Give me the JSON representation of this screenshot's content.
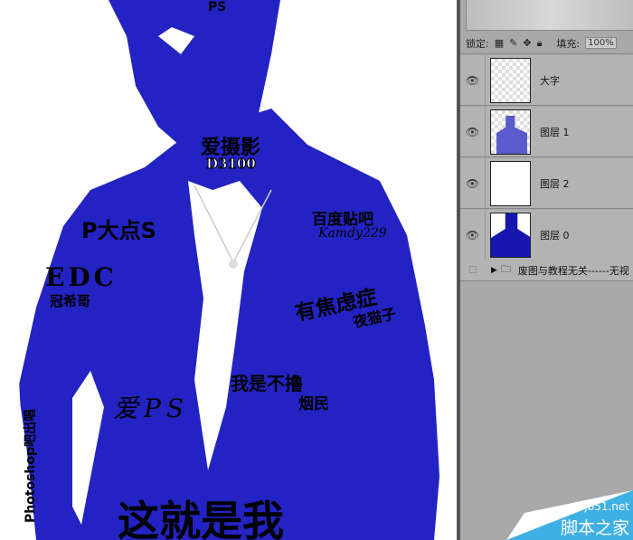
{
  "canvas": {
    "texts": {
      "ps": "PS",
      "love_photo": "爱摄影",
      "camera": "D3100",
      "p_big": "P大点S",
      "baidu": "百度贴吧",
      "kamdy": "Kamdy229",
      "edc": "EDC",
      "guanxi": "冠希哥",
      "anxiety": "有焦虑症",
      "nightowl": "夜猫子",
      "no_smoke": "我是不撸",
      "smoker": "烟民",
      "love_ps": "爱PS",
      "vertical": "Photoshop吧出唱",
      "this_is_me": "这就是我"
    },
    "fill_color": "#2323c4"
  },
  "panel": {
    "lock_label": "锁定:",
    "fill_label": "填充:",
    "fill_value": "100%",
    "layers": [
      {
        "name": "大字",
        "visible": true
      },
      {
        "name": "图层 1",
        "visible": true
      },
      {
        "name": "图层 2",
        "visible": true
      },
      {
        "name": "图层 0",
        "visible": true
      }
    ],
    "group": {
      "name": "废图与教程无关------无视"
    }
  },
  "watermark": {
    "url": "jb51.net",
    "name": "脚本之家"
  }
}
